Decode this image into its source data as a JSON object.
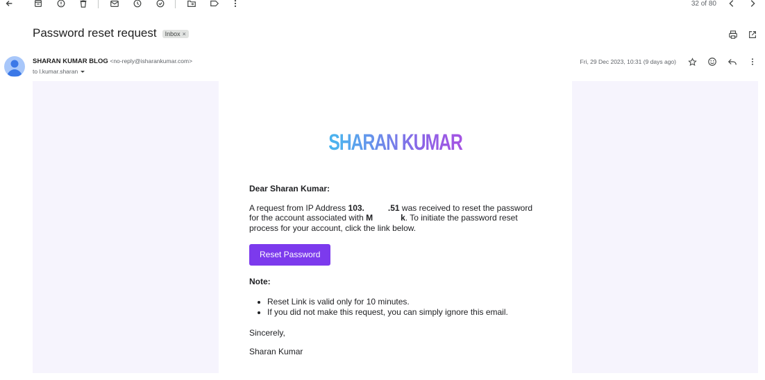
{
  "toolbar": {
    "back_icon": "arrow-left-icon",
    "pager_text": "32 of 80"
  },
  "subject": {
    "title": "Password reset request",
    "label": "Inbox",
    "label_remove": "×"
  },
  "sender": {
    "name": "SHARAN KUMAR BLOG",
    "email": "<no-reply@isharankumar.com>",
    "to": "to l.kumar.sharan",
    "date": "Fri, 29 Dec 2023, 10:31 (9 days ago)"
  },
  "email": {
    "logo_text": "SHARAN KUMAR",
    "greeting": "Dear Sharan Kumar:",
    "para_prefix": "A request from IP Address ",
    "ip_visible_start": "103.",
    "ip_visible_end": ".51",
    "para_mid": " was received to reset the password for the account associated with ",
    "account_visible_start": "M",
    "account_visible_end": "k",
    "para_suffix": ". To initiate the password reset process for your account, click the link below.",
    "button_label": "Reset Password",
    "note_heading": "Note:",
    "notes": [
      "Reset Link is valid only for 10 minutes.",
      "If you did not make this request, you can simply ignore this email."
    ],
    "signoff": "Sincerely,",
    "signature": "Sharan Kumar"
  },
  "colors": {
    "button": "#7c3aed",
    "email_background": "#f6f4fd",
    "logo_gradient_start": "#22c6f0",
    "logo_gradient_end": "#d436dd"
  }
}
